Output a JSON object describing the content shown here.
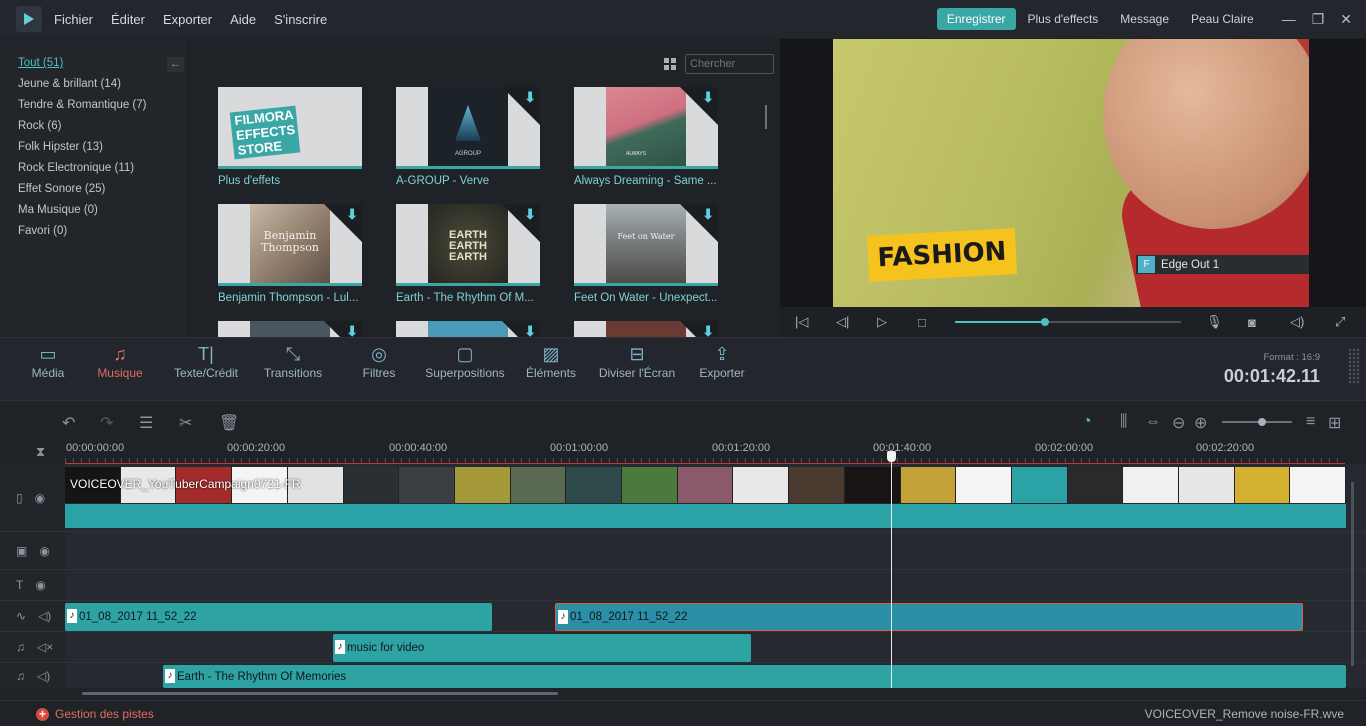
{
  "menu": {
    "items": [
      "Fichier",
      "Éditer",
      "Exporter",
      "Aide",
      "S'inscrire"
    ]
  },
  "topright": {
    "register": "Enregistrer",
    "more_effects": "Plus d'effects",
    "message": "Message",
    "skin": "Peau Claire"
  },
  "categories": [
    "Tout (51)",
    "Jeune & brillant (14)",
    "Tendre & Romantique (7)",
    "Rock (6)",
    "Folk Hipster (13)",
    "Rock Electronique (11)",
    "Effet Sonore (25)",
    "Ma Musique (0)",
    "Favori (0)"
  ],
  "search": {
    "placeholder": "Chercher"
  },
  "tiles": [
    {
      "label": "Plus d'effets",
      "art": "FILMORA EFFECTS STORE"
    },
    {
      "label": "A-GROUP - Verve",
      "art": "AGROUP"
    },
    {
      "label": "Always Dreaming - Same ...",
      "art": "ALWAYS"
    },
    {
      "label": "Benjamin Thompson - Lul...",
      "art": "Benjamin Thompson"
    },
    {
      "label": "Earth - The Rhythm Of M...",
      "art": "EARTH EARTH EARTH"
    },
    {
      "label": "Feet On Water - Unexpect...",
      "art": "Feet on Water"
    }
  ],
  "preview": {
    "title_card": "FASHION",
    "effect": "Edge Out 1",
    "effect_badge": "F"
  },
  "toolbar": {
    "items": [
      "Média",
      "Musique",
      "Texte/Crédit",
      "Transitions",
      "Filtres",
      "Superpositions",
      "Éléments",
      "Diviser l'Écran",
      "Exporter"
    ],
    "active": "Musique"
  },
  "format": "Format : 16:9",
  "timecode": "00:01:42.11",
  "ruler": [
    "00:00:00:00",
    "00:00:20:00",
    "00:00:40:00",
    "00:01:00:00",
    "00:01:20:00",
    "00:01:40:00",
    "00:02:00:00",
    "00:02:20:00"
  ],
  "video_clip": "VOICEOVER_YouTuberCampaign0721-FR",
  "audio_clips": {
    "a1": "01_08_2017 11_52_22",
    "a2": "01_08_2017 11_52_22",
    "m1": "music for video",
    "m2": "Earth - The Rhythm Of Memories"
  },
  "bottom": {
    "manage": "Gestion des pistes",
    "project": "VOICEOVER_Remove noise-FR.wve"
  },
  "colors": {
    "accent": "#3aa7a7",
    "active": "#e06d5f"
  }
}
